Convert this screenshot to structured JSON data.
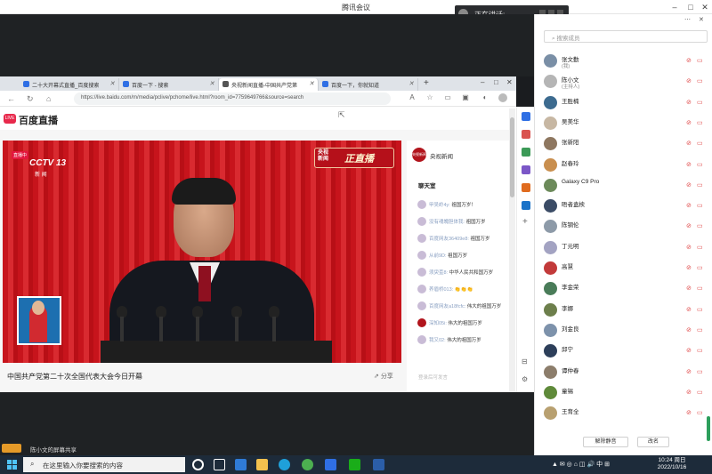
{
  "window": {
    "title": "腾讯会议"
  },
  "speaking": {
    "label": "正在讲话:"
  },
  "browser": {
    "tabs": [
      {
        "label": "二十大开幕式直播_百度搜索"
      },
      {
        "label": "百度一下 - 搜索"
      },
      {
        "label": "央视新闻直播-中国共产党第"
      },
      {
        "label": "百度一下，你就知道"
      }
    ],
    "url": "https://live.baidu.com/m/media/pclive/pchome/live.html?room_id=7759649766&source=search"
  },
  "page": {
    "logo_badge": "LIVE",
    "logo": "百度直播",
    "cctv": {
      "badge": "直播中",
      "channel": "CCTV 13",
      "sub": "新 闻"
    },
    "live_badge": {
      "l1": "央视",
      "l2": "新闻",
      "big": "正直播"
    },
    "video_title": "中国共产党第二十次全国代表大会今日开幕",
    "share": "分享",
    "channel_avatar": "央视新闻",
    "channel_name": "央视新闻",
    "chat_title": "聊天室",
    "chat": [
      {
        "user": "甲吴岭4y:",
        "msg": "祖国万岁！"
      },
      {
        "user": "没有魂魄胆体我:",
        "msg": "祖国万岁"
      },
      {
        "user": "百度网友36409e8:",
        "msg": "祖国万岁"
      },
      {
        "user": "从前9D:",
        "msg": "祖国万岁"
      },
      {
        "user": "须臾歪8:",
        "msg": "中华人民共和国万岁"
      },
      {
        "user": "养眉桥013:",
        "msg": "👏👏👏"
      },
      {
        "user": "百度网友a18fcfc:",
        "msg": "伟大的祖国万岁"
      },
      {
        "user": "深知05i:",
        "msg": "伟大的祖国万岁"
      },
      {
        "user": "我又02:",
        "msg": "伟大的祖国万岁"
      }
    ],
    "chat_input": "登录后可发言"
  },
  "share_label": "陈小文的屏幕共享",
  "panel": {
    "search_placeholder": "搜索成员",
    "members": [
      {
        "name": "张文勤",
        "sub": "(我)",
        "color": "#7a8fa6"
      },
      {
        "name": "陈小文",
        "sub": "(主持人)",
        "color": "#b5b5b5"
      },
      {
        "name": "王胜楠",
        "sub": "",
        "color": "#3d6b8f"
      },
      {
        "name": "吴美华",
        "sub": "",
        "color": "#c7b7a3"
      },
      {
        "name": "张新阳",
        "sub": "",
        "color": "#8e7760"
      },
      {
        "name": "赵春玲",
        "sub": "",
        "color": "#c98f4f"
      },
      {
        "name": "Galaxy C9 Pro",
        "sub": "",
        "color": "#6c8a5a"
      },
      {
        "name": "晤者盍椟",
        "sub": "",
        "color": "#3b4c66"
      },
      {
        "name": "陈钢伦",
        "sub": "",
        "color": "#8d9aa8"
      },
      {
        "name": "丁元明",
        "sub": "",
        "color": "#a3a3c2"
      },
      {
        "name": "高慧",
        "sub": "",
        "color": "#c23a3a"
      },
      {
        "name": "李金荣",
        "sub": "",
        "color": "#4a7c59"
      },
      {
        "name": "李娜",
        "sub": "",
        "color": "#6d7f4c"
      },
      {
        "name": "刘金良",
        "sub": "",
        "color": "#7d92ab"
      },
      {
        "name": "邱宁",
        "sub": "",
        "color": "#2d3f5a"
      },
      {
        "name": "谭仲春",
        "sub": "",
        "color": "#8c7d6b"
      },
      {
        "name": "童锡",
        "sub": "",
        "color": "#5f8a3a"
      },
      {
        "name": "王育全",
        "sub": "",
        "color": "#b8a070"
      }
    ],
    "mute_all": "解除静音",
    "rename": "改名"
  },
  "taskbar": {
    "search": "在这里输入你要搜索的内容",
    "tray": "中",
    "time": "10:24 周日",
    "date": "2022/10/16"
  }
}
